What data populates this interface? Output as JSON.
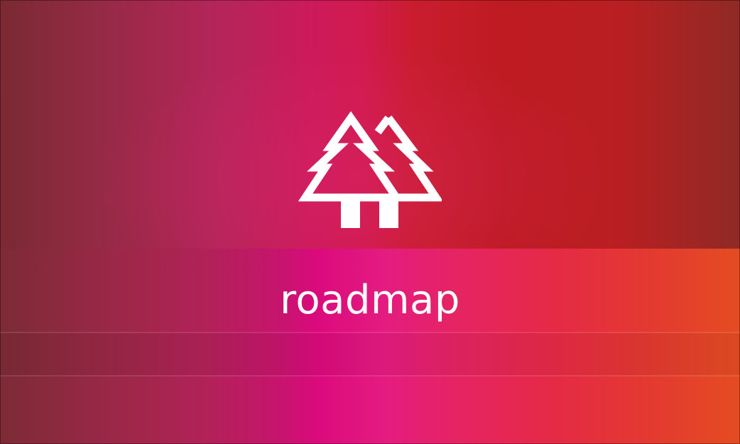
{
  "app": {
    "title": "roadmap",
    "logo_icon": "pine-trees-icon"
  },
  "colors": {
    "text": "#ffffff",
    "accent_left": "#7a2a33",
    "accent_mid": "#d11a4f",
    "accent_right": "#e44c22"
  }
}
